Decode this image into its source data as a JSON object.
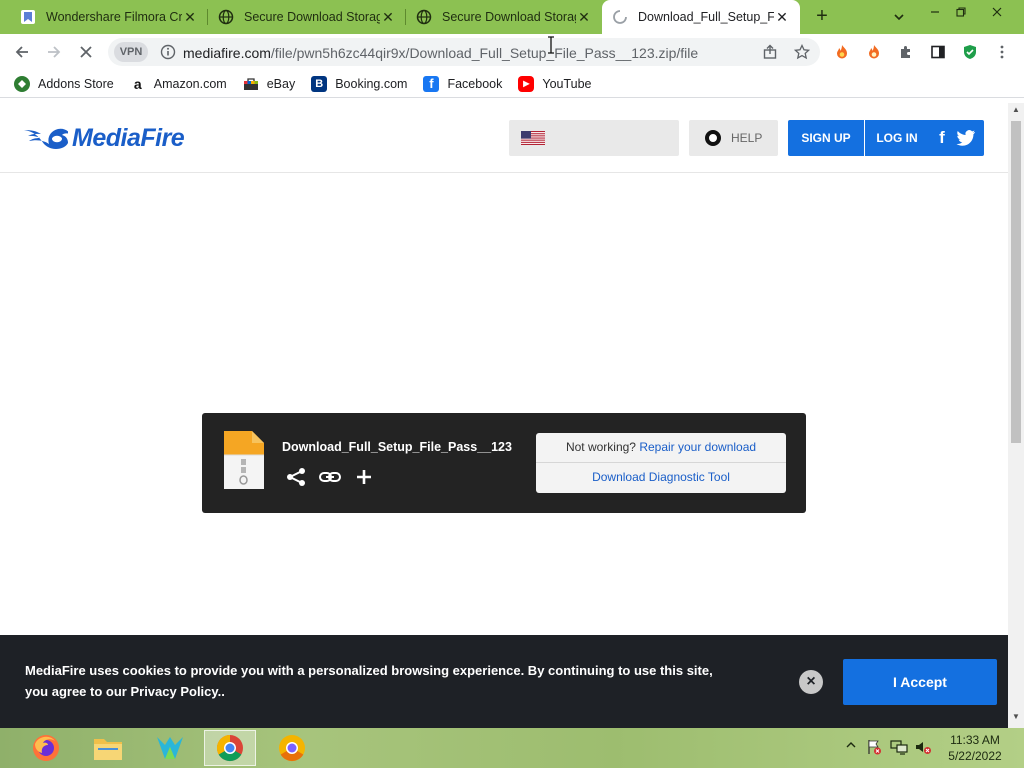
{
  "browser": {
    "tabs": [
      {
        "title": "Wondershare Filmora Cra",
        "favicon": "wondershare-icon",
        "active": false
      },
      {
        "title": "Secure Download Storag",
        "favicon": "globe-icon",
        "active": false
      },
      {
        "title": "Secure Download Storag",
        "favicon": "globe-icon",
        "active": false
      },
      {
        "title": "Download_Full_Setup_Fil",
        "favicon": "loading-spinner-icon",
        "active": true
      }
    ],
    "close_glyph": "✕",
    "new_tab_glyph": "+",
    "vpn_label": "VPN",
    "url_host": "mediafire.com",
    "url_path": "/file/pwn5h6zc44qir9x/Download_Full_Setup_File_Pass__123.zip/file",
    "bookmarks": [
      {
        "label": "Addons Store",
        "icon": "addons-store-icon",
        "color": "#2e7d32",
        "glyph": "◆"
      },
      {
        "label": "Amazon.com",
        "icon": "amazon-icon",
        "color": "#ffffff",
        "glyph": "a"
      },
      {
        "label": "eBay",
        "icon": "ebay-icon",
        "color": "#ffffff",
        "glyph": "▦"
      },
      {
        "label": "Booking.com",
        "icon": "booking-icon",
        "color": "#003580",
        "glyph": "B"
      },
      {
        "label": "Facebook",
        "icon": "facebook-icon",
        "color": "#1877f2",
        "glyph": "f"
      },
      {
        "label": "YouTube",
        "icon": "youtube-icon",
        "color": "#ff0000",
        "glyph": "▶"
      }
    ]
  },
  "mediafire": {
    "logo_text": "MediaFire",
    "help_label": "HELP",
    "signup_label": "SIGN UP",
    "login_label": "LOG IN",
    "file_name": "Download_Full_Setup_File_Pass__123",
    "repair_prefix": "Not working?",
    "repair_link": "Repair your download",
    "diagnostic_label": "Download Diagnostic Tool",
    "cookie_text": "MediaFire uses cookies to provide you with a personalized browsing experience. By continuing to use this site, you agree to our Privacy Policy..",
    "accept_label": "I Accept",
    "brand_color": "#1470e0"
  },
  "taskbar": {
    "time": "11:33 AM",
    "date": "5/22/2022"
  }
}
